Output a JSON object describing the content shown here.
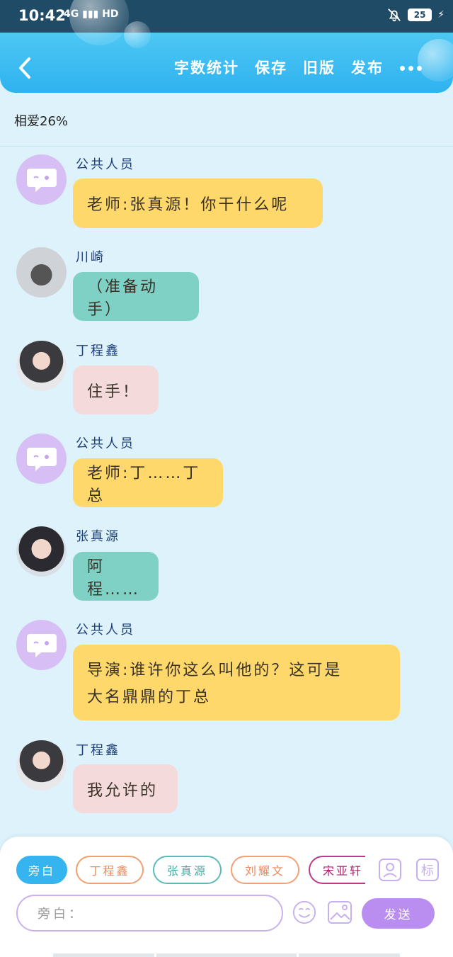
{
  "status_bar": {
    "time": "10:42",
    "network": "4G",
    "network_label": "HD",
    "battery": "25"
  },
  "header": {
    "back_icon": "chevron-left-icon",
    "actions": [
      "字数统计",
      "保存",
      "旧版",
      "发布"
    ],
    "more_icon": "more-dots-icon"
  },
  "story": {
    "title": "相爱26%"
  },
  "messages": [
    {
      "sender": "公共人员",
      "text": "老师:张真源！你干什么呢",
      "color": "#fed86a"
    },
    {
      "sender": "川崎",
      "text": "（准备动手）",
      "color": "#7fd1c6"
    },
    {
      "sender": "丁程鑫",
      "text": "住手！",
      "color": "#f5dadb"
    },
    {
      "sender": "公共人员",
      "text": "老师:丁……丁总",
      "color": "#fed86a"
    },
    {
      "sender": "张真源",
      "text": "阿程……",
      "color": "#7fd1c6"
    },
    {
      "sender": "公共人员",
      "lines": [
        "导演:谁许你这么叫他的？这可是",
        "大名鼎鼎的丁总"
      ],
      "color": "#fed86a"
    },
    {
      "sender": "丁程鑫",
      "text": "我允许的",
      "color": "#f5dadb"
    }
  ],
  "roles": [
    "旁白",
    "丁程鑫",
    "张真源",
    "刘耀文",
    "宋亚轩"
  ],
  "tools": {
    "role_manage_icon": "person-card-icon",
    "tag_icon": "tag-icon",
    "emoji_icon": "smile-icon",
    "image_icon": "image-icon"
  },
  "composer": {
    "placeholder": "旁白：",
    "send_label": "发送"
  }
}
